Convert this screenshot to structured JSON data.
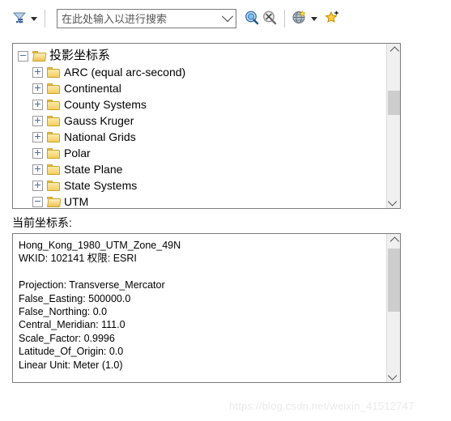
{
  "toolbar": {
    "filter_icon": "filter-funnel-icon",
    "filter_dropdown_icon": "chevron-down-icon",
    "search": {
      "value": "",
      "placeholder": "在此处输入以进行搜索",
      "dropdown_icon": "chevron-down-icon"
    },
    "search_button_icon": "search-magnifier-icon",
    "clear_search_button_icon": "cancel-search-icon",
    "globe_button_icon": "globe-icon",
    "globe_dropdown_icon": "chevron-down-icon",
    "favorites_button_icon": "add-favorite-star-icon"
  },
  "tree": {
    "nodes": [
      {
        "label": "投影坐标系",
        "level": 0,
        "state": "expanded",
        "folder": "open",
        "cjk": true
      },
      {
        "label": "ARC (equal arc-second)",
        "level": 1,
        "state": "collapsed",
        "folder": "closed",
        "cjk": false
      },
      {
        "label": "Continental",
        "level": 1,
        "state": "collapsed",
        "folder": "closed",
        "cjk": false
      },
      {
        "label": "County Systems",
        "level": 1,
        "state": "collapsed",
        "folder": "closed",
        "cjk": false
      },
      {
        "label": "Gauss Kruger",
        "level": 1,
        "state": "collapsed",
        "folder": "closed",
        "cjk": false
      },
      {
        "label": "National Grids",
        "level": 1,
        "state": "collapsed",
        "folder": "closed",
        "cjk": false
      },
      {
        "label": "Polar",
        "level": 1,
        "state": "collapsed",
        "folder": "closed",
        "cjk": false
      },
      {
        "label": "State Plane",
        "level": 1,
        "state": "collapsed",
        "folder": "closed",
        "cjk": false
      },
      {
        "label": "State Systems",
        "level": 1,
        "state": "collapsed",
        "folder": "closed",
        "cjk": false
      },
      {
        "label": "UTM",
        "level": 1,
        "state": "expanded",
        "folder": "open",
        "cjk": false
      }
    ],
    "scrollbar": {
      "up_icon": "chevron-up-icon",
      "down_icon": "chevron-down-icon"
    }
  },
  "current_cs": {
    "label": "当前坐标系:",
    "lines": [
      "Hong_Kong_1980_UTM_Zone_49N",
      "WKID: 102141 权限: ESRI",
      "",
      "Projection: Transverse_Mercator",
      "False_Easting: 500000.0",
      "False_Northing: 0.0",
      "Central_Meridian: 111.0",
      "Scale_Factor: 0.9996",
      "Latitude_Of_Origin: 0.0",
      "Linear Unit: Meter (1.0)"
    ],
    "scrollbar": {
      "up_icon": "chevron-up-icon",
      "down_icon": "chevron-down-icon"
    }
  },
  "watermark": "https://blog.csdn.net/weixin_41512747"
}
